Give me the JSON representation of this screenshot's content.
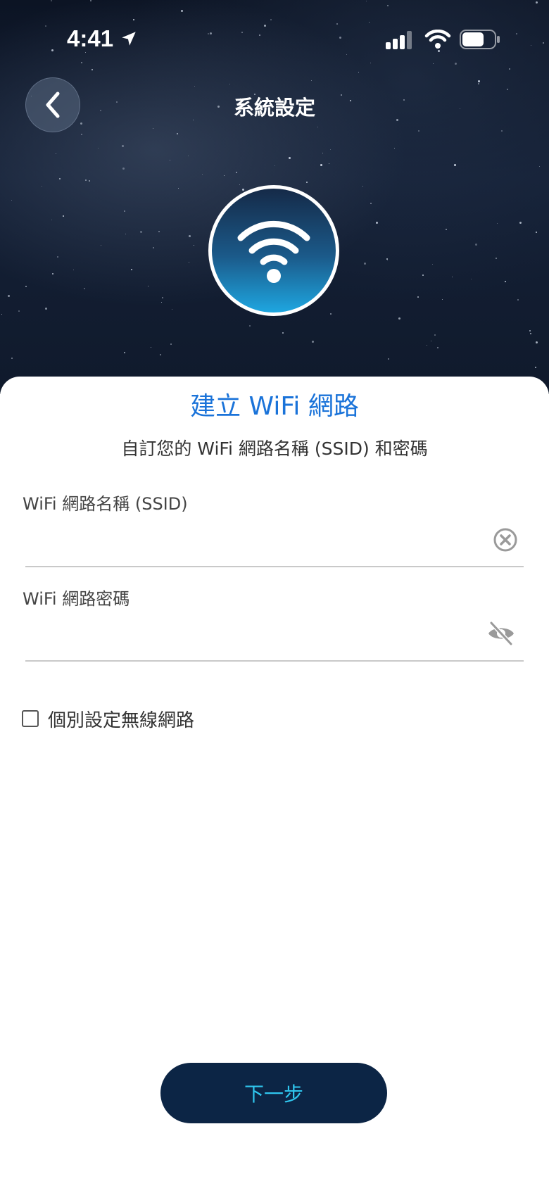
{
  "status_bar": {
    "time": "4:41"
  },
  "header": {
    "title": "系統設定"
  },
  "sheet": {
    "title": "建立 WiFi 網路",
    "subtitle": "自訂您的 WiFi 網路名稱 (SSID) 和密碼"
  },
  "fields": {
    "ssid": {
      "label": "WiFi 網路名稱 (SSID)",
      "value": ""
    },
    "password": {
      "label": "WiFi 網路密碼",
      "value": ""
    }
  },
  "option": {
    "label": "個別設定無線網路",
    "checked": false
  },
  "footer": {
    "next_label": "下一步"
  },
  "colors": {
    "accent": "#1a73d9",
    "button_bg": "#0c2545",
    "button_text": "#2fc6ee"
  },
  "icons": [
    "back-icon",
    "location-arrow-icon",
    "signal-icon",
    "wifi-icon",
    "battery-icon",
    "clear-icon",
    "eye-off-icon"
  ]
}
